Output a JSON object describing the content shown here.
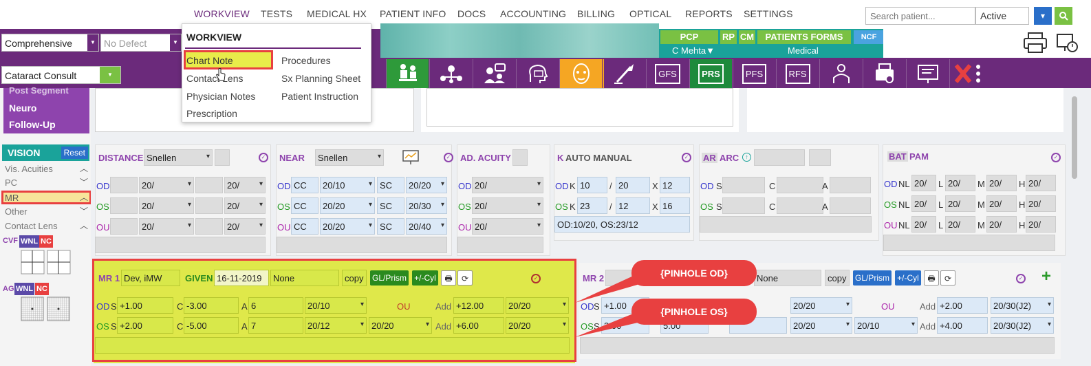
{
  "topnav": {
    "items": [
      "WORKVIEW",
      "TESTS",
      "MEDICAL HX",
      "PATIENT INFO",
      "DOCS",
      "ACCOUNTING",
      "BILLING",
      "OPTICAL",
      "REPORTS",
      "SETTINGS"
    ],
    "search_placeholder": "Search patient...",
    "status": "Active"
  },
  "toolbar": {
    "exam_type": "Comprehensive",
    "defect": "No Defect",
    "template": "Cataract Consult",
    "pcp": "PCP",
    "rp": "RP",
    "cm": "CM",
    "patient_forms": "PATIENTS FORMS",
    "ncf": "NCF",
    "provider": "C Mehta▼",
    "insurance": "Medical"
  },
  "icons": {
    "labels": [
      "GFS",
      "PRS",
      "PFS",
      "RFS"
    ]
  },
  "menu": {
    "title": "WORKVIEW",
    "col1": [
      "Chart Note",
      "Contact Lens",
      "Physician Notes",
      "Prescription"
    ],
    "col2": [
      "Procedures",
      "Sx Planning Sheet",
      "Patient Instruction"
    ]
  },
  "left": {
    "menu_items": [
      "Post Segment",
      "Neuro",
      "Follow-Up"
    ],
    "vision_title": "VISION",
    "reset": "Reset",
    "sections": [
      "Vis. Acuities",
      "PC",
      "MR",
      "Other",
      "Contact Lens"
    ],
    "cvf": "CVF",
    "ag": "AG",
    "wnl": "WNL",
    "nc": "NC"
  },
  "distance": {
    "title": "DISTANCE",
    "method": "Snellen",
    "rows": [
      {
        "eye": "OD",
        "a": "20/",
        "b": "20/"
      },
      {
        "eye": "OS",
        "a": "20/",
        "b": "20/"
      },
      {
        "eye": "OU",
        "a": "20/",
        "b": "20/"
      }
    ]
  },
  "near": {
    "title": "NEAR",
    "method": "Snellen",
    "rows": [
      {
        "eye": "OD",
        "cc": "CC",
        "v1": "20/10",
        "sc": "SC",
        "v2": "20/20"
      },
      {
        "eye": "OS",
        "cc": "CC",
        "v1": "20/20",
        "sc": "SC",
        "v2": "20/30"
      },
      {
        "eye": "OU",
        "cc": "CC",
        "v1": "20/20",
        "sc": "SC",
        "v2": "20/40"
      }
    ]
  },
  "acuity": {
    "title": "AD. ACUITY",
    "rows": [
      {
        "eye": "OD",
        "v": "20/"
      },
      {
        "eye": "OS",
        "v": "20/"
      },
      {
        "eye": "OU",
        "v": "20/"
      }
    ]
  },
  "kauto": {
    "title_k": "K",
    "title": "AUTO MANUAL",
    "rows": [
      {
        "eye": "OD",
        "k": "K",
        "a": "10",
        "sep": "/",
        "b": "20",
        "x": "X",
        "c": "12"
      },
      {
        "eye": "OS",
        "k": "K",
        "a": "23",
        "sep": "/",
        "b": "12",
        "x": "X",
        "c": "16"
      }
    ],
    "summary": "OD:10/20, OS:23/12"
  },
  "ar": {
    "title": "AR",
    "title2": "ARC",
    "rows": [
      {
        "eye": "OD",
        "s": "S",
        "c": "C",
        "a": "A"
      },
      {
        "eye": "OS",
        "s": "S",
        "c": "C",
        "a": "A"
      }
    ]
  },
  "bat": {
    "title": "BAT",
    "title2": "PAM",
    "rows": [
      {
        "eye": "OD",
        "nl": "NL",
        "v1": "20/",
        "l": "L",
        "v2": "20/",
        "m": "M",
        "v3": "20/",
        "h": "H",
        "v4": "20/"
      },
      {
        "eye": "OS",
        "nl": "NL",
        "v1": "20/",
        "l": "L",
        "v2": "20/",
        "m": "M",
        "v3": "20/",
        "h": "H",
        "v4": "20/"
      },
      {
        "eye": "OU",
        "nl": "NL",
        "v1": "20/",
        "l": "L",
        "v2": "20/",
        "m": "M",
        "v3": "20/",
        "h": "H",
        "v4": "20/"
      }
    ]
  },
  "mr1": {
    "title": "MR 1",
    "provider": "Dev, iMW",
    "given": "GIVEN",
    "date": "16-11-2019",
    "none": "None",
    "copy": "copy",
    "glprism": "GL/Prism",
    "cyl": "+/-Cyl",
    "ou": "OU",
    "add": "Add",
    "od": {
      "eye": "OD",
      "s": "S",
      "sv": "+1.00",
      "c": "C",
      "cv": "-3.00",
      "a": "A",
      "av": "6",
      "va": "20/10",
      "addv": "+12.00",
      "addva": "20/20"
    },
    "os": {
      "eye": "OS",
      "s": "S",
      "sv": "+2.00",
      "c": "C",
      "cv": "-5.00",
      "a": "A",
      "av": "7",
      "va": "20/12",
      "ouva": "20/20",
      "addv": "+6.00",
      "addva": "20/20"
    }
  },
  "mr2": {
    "title": "MR 2",
    "none": "None",
    "copy": "copy",
    "glprism": "GL/Prism",
    "cyl": "+/-Cyl",
    "ou": "OU",
    "add": "Add",
    "od": {
      "eye": "OD",
      "s": "S",
      "sv": "+1.00",
      "va": "20/20",
      "addv": "+2.00",
      "addva": "20/30(J2)"
    },
    "os": {
      "eye": "OS",
      "s": "S",
      "sv": "3.00",
      "cv": "5.00",
      "va": "20/20",
      "ouva": "20/10",
      "addv": "+4.00",
      "addva": "20/30(J2)"
    }
  },
  "callouts": {
    "od": "{PINHOLE OD}",
    "os": "{PINHOLE OS}"
  }
}
